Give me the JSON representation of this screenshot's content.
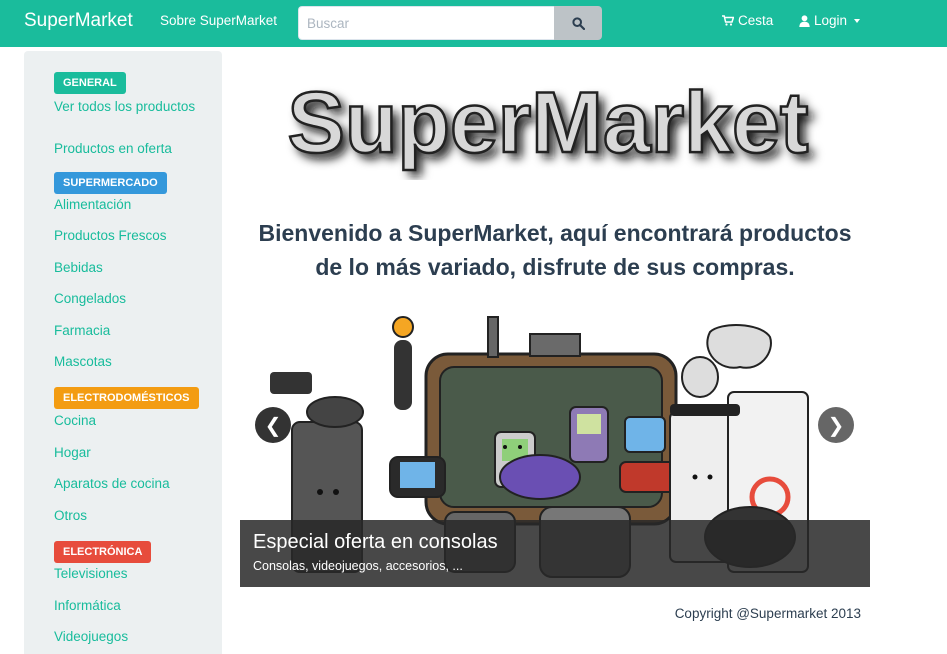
{
  "navbar": {
    "brand": "SuperMarket",
    "about": "Sobre SuperMarket",
    "search_placeholder": "Buscar",
    "cart": "Cesta",
    "login": "Login"
  },
  "sidebar": {
    "groups": [
      {
        "badge": "GENERAL",
        "color": "#1abc9c",
        "items": [
          "Ver todos los productos",
          "Productos en oferta"
        ]
      },
      {
        "badge": "SUPERMERCADO",
        "color": "#3498db",
        "items": [
          "Alimentación",
          "Productos Frescos",
          "Bebidas",
          "Congelados",
          "Farmacia",
          "Mascotas"
        ]
      },
      {
        "badge": "ELECTRODOMÉSTICOS",
        "color": "#f39c12",
        "items": [
          "Cocina",
          "Hogar",
          "Aparatos de cocina",
          "Otros"
        ]
      },
      {
        "badge": "ELECTRÓNICA",
        "color": "#e74c3c",
        "items": [
          "Televisiones",
          "Informática",
          "Videojuegos"
        ]
      }
    ]
  },
  "main": {
    "logo_text": "SuperMarket",
    "welcome_line1": "Bienvenido a SuperMarket, aquí encontrará productos",
    "welcome_line2": "de lo más variado, disfrute de sus compras.",
    "carousel": {
      "caption_title": "Especial oferta en consolas",
      "caption_subtitle": "Consolas, videojuegos, accesorios, ...",
      "prev": "❮",
      "next": "❯"
    },
    "copyright": "Copyright @Supermarket 2013"
  },
  "colors": {
    "primary": "#1abc9c",
    "link": "#18bc9c",
    "sidebar_bg": "#ecf0f1",
    "text": "#2c3e50"
  }
}
